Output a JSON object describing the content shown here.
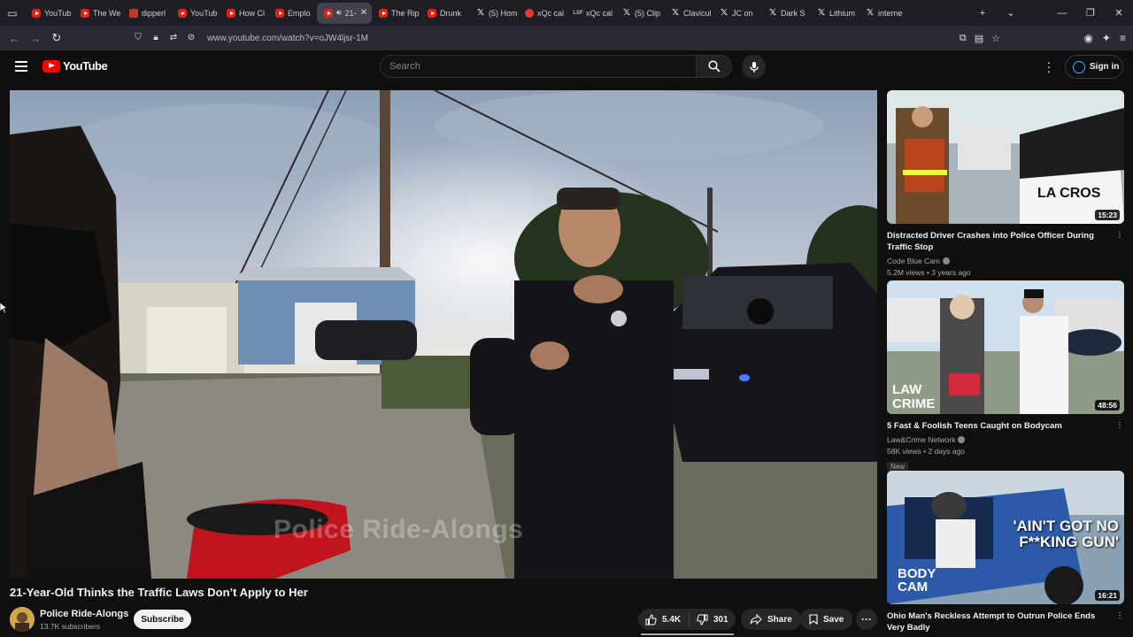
{
  "browser": {
    "tabs": [
      {
        "icon": "youtube",
        "title": "YouTub"
      },
      {
        "icon": "youtube",
        "title": "The We"
      },
      {
        "icon": "dipper",
        "title": "dipperl"
      },
      {
        "icon": "youtube",
        "title": "YouTub"
      },
      {
        "icon": "youtube",
        "title": "How Ci"
      },
      {
        "icon": "youtube",
        "title": "Emplo"
      },
      {
        "icon": "youtube",
        "title": "21-",
        "active": true
      },
      {
        "icon": "youtube",
        "title": "The Rip"
      },
      {
        "icon": "youtube",
        "title": "Drunk"
      },
      {
        "icon": "x",
        "title": "(5) Hom"
      },
      {
        "icon": "xqc",
        "title": "xQc cal"
      },
      {
        "icon": "lsf",
        "title": "xQc cal"
      },
      {
        "icon": "x",
        "title": "(5) Clip"
      },
      {
        "icon": "x",
        "title": "Clavicul"
      },
      {
        "icon": "x",
        "title": "JC on"
      },
      {
        "icon": "x",
        "title": "Dark S"
      },
      {
        "icon": "x",
        "title": "Lithium"
      },
      {
        "icon": "x",
        "title": "interne"
      }
    ],
    "url": "www.youtube.com/watch?v=oJW4ljsr-1M"
  },
  "youtube": {
    "logo_text": "YouTube",
    "search_placeholder": "Search",
    "signin_label": "Sign in"
  },
  "video": {
    "title": "21-Year-Old Thinks the Traffic Laws Don’t Apply to Her",
    "watermark": "Police Ride-Alongs",
    "channel_name": "Police Ride-Alongs",
    "subscribers": "13.7K subscribers",
    "subscribe_label": "Subscribe",
    "likes": "5.4K",
    "dislikes": "301",
    "share_label": "Share",
    "save_label": "Save"
  },
  "recommendations": [
    {
      "title": "Distracted Driver Crashes into Police Officer During Traffic Stop",
      "channel": "Code Blue Cam",
      "meta": "5.2M views • 3 years ago",
      "duration": "15:23",
      "thumb_text": "LA CROS"
    },
    {
      "title": "5 Fast & Foolish Teens Caught on Bodycam",
      "channel": "Law&Crime Network",
      "meta": "58K views • 2 days ago",
      "badge": "New",
      "duration": "48:56",
      "thumb_text_1": "LAW",
      "thumb_text_2": "CRIME"
    },
    {
      "title": "Ohio Man's Reckless Attempt to Outrun Police Ends Very Badly",
      "channel": "",
      "duration": "16:21",
      "thumb_text_1": "'AIN'T GOT NO",
      "thumb_text_2": "F**KING GUN'",
      "thumb_text_3": "BODY",
      "thumb_text_4": "CAM"
    }
  ],
  "colors": {
    "background": "#0f0f0f",
    "youtube_red": "#ff0000",
    "signin_blue": "#3ea6ff"
  }
}
